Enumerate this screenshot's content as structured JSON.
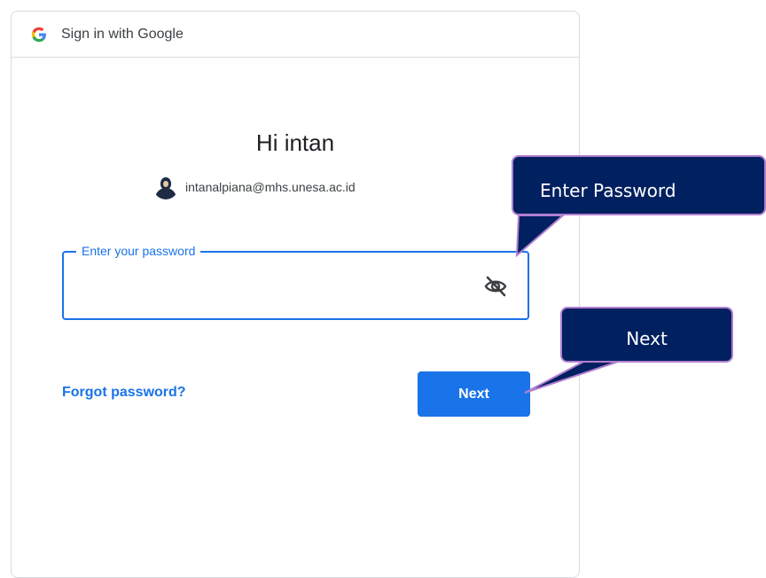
{
  "header": {
    "title": "Sign in with Google",
    "logo_icon": "google-g-icon"
  },
  "greeting": "Hi intan",
  "account": {
    "email": "intanalpiana@mhs.unesa.ac.id",
    "avatar_icon": "user-avatar"
  },
  "password_field": {
    "label": "Enter your password",
    "value": "",
    "visibility_icon": "eye-off-icon"
  },
  "actions": {
    "forgot_label": "Forgot password?",
    "next_label": "Next"
  },
  "callouts": {
    "password": "Enter Password",
    "next": "Next"
  },
  "colors": {
    "accent": "#1a73e8",
    "callout_bg": "#002060",
    "callout_border": "#b27fd0",
    "border": "#dadce0"
  }
}
